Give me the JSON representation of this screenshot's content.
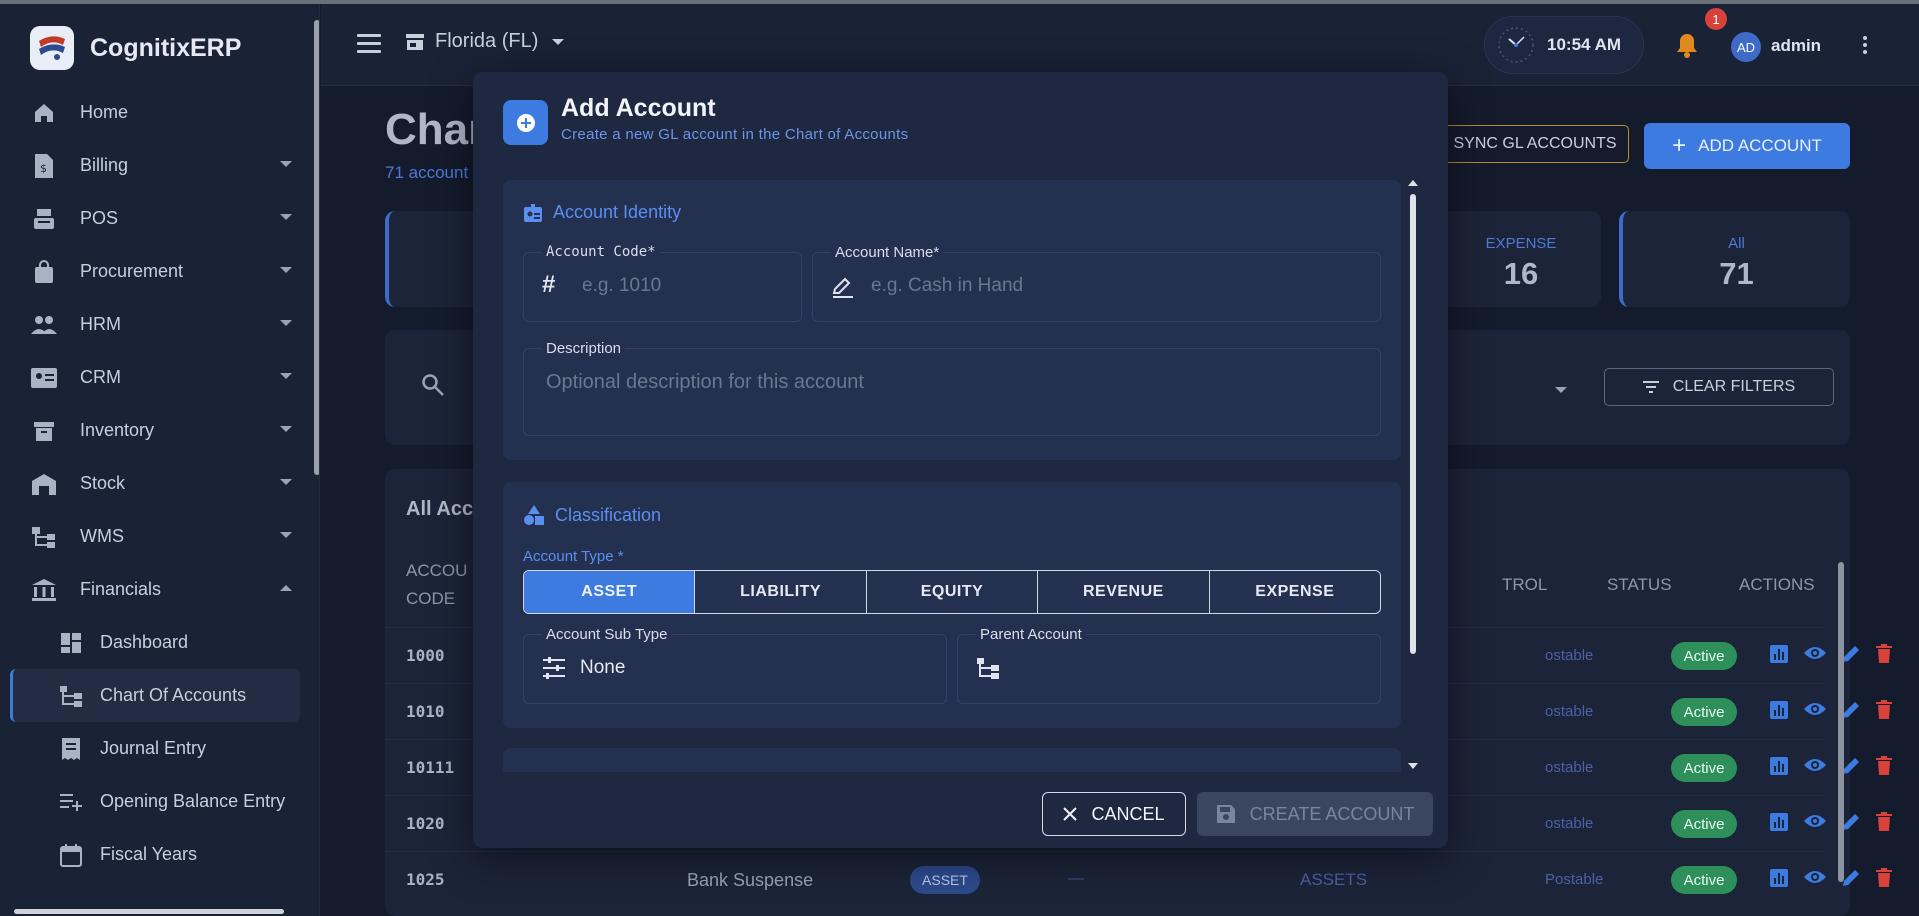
{
  "app": {
    "name": "CognitixERP"
  },
  "sidebar": {
    "items": [
      {
        "label": "Home",
        "icon": "home-icon"
      },
      {
        "label": "Billing",
        "icon": "billing-icon"
      },
      {
        "label": "POS",
        "icon": "pos-icon"
      },
      {
        "label": "Procurement",
        "icon": "bag-icon"
      },
      {
        "label": "HRM",
        "icon": "people-icon"
      },
      {
        "label": "CRM",
        "icon": "contact-card-icon"
      },
      {
        "label": "Inventory",
        "icon": "archive-icon"
      },
      {
        "label": "Stock",
        "icon": "warehouse-icon"
      },
      {
        "label": "WMS",
        "icon": "tree-icon"
      },
      {
        "label": "Financials",
        "icon": "bank-icon"
      }
    ],
    "financials_sub": [
      {
        "label": "Dashboard",
        "icon": "dashboard-icon"
      },
      {
        "label": "Chart Of Accounts",
        "icon": "account-tree-icon"
      },
      {
        "label": "Journal Entry",
        "icon": "receipt-icon"
      },
      {
        "label": "Opening Balance Entry",
        "icon": "playlist-add-icon"
      },
      {
        "label": "Fiscal Years",
        "icon": "calendar-icon"
      }
    ]
  },
  "topbar": {
    "store": "Florida (FL)",
    "time": "10:54 AM",
    "notifications": "1",
    "avatar_initials": "AD",
    "user": "admin"
  },
  "page": {
    "title": "Char",
    "subtitle": "71 account",
    "sync_button": "SYNC GL ACCOUNTS",
    "add_button": "ADD ACCOUNT",
    "clear_filters": "CLEAR FILTERS",
    "table_title": "All Acc"
  },
  "stats": [
    {
      "label": "EXPENSE",
      "value": "16"
    },
    {
      "label": "All",
      "value": "71"
    }
  ],
  "table": {
    "headers": {
      "code_1": "ACCOU",
      "code_2": "CODE",
      "control": "TROL",
      "status": "STATUS",
      "actions": "ACTIONS"
    },
    "rows": [
      {
        "code": "1000",
        "postable": "ostable",
        "status": "Active"
      },
      {
        "code": "1010",
        "postable": "ostable",
        "status": "Active"
      },
      {
        "code": "10111",
        "postable": "ostable",
        "status": "Active"
      },
      {
        "code": "1020",
        "postable": "ostable",
        "status": "Active"
      },
      {
        "code": "1025",
        "name": "Bank Suspense",
        "type": "ASSET",
        "parent": "—",
        "group": "ASSETS",
        "postable": "Postable",
        "status": "Active"
      }
    ]
  },
  "modal": {
    "title": "Add Account",
    "subtitle": "Create a new GL account in the Chart of Accounts",
    "identity": {
      "heading": "Account Identity",
      "code_label": "Account Code*",
      "code_placeholder": "e.g. 1010",
      "name_label": "Account Name*",
      "name_placeholder": "e.g. Cash in Hand",
      "desc_label": "Description",
      "desc_placeholder": "Optional description for this account"
    },
    "classification": {
      "heading": "Classification",
      "type_label": "Account Type *",
      "types": [
        "ASSET",
        "LIABILITY",
        "EQUITY",
        "REVENUE",
        "EXPENSE"
      ],
      "selected": "ASSET",
      "subtype_label": "Account Sub Type",
      "subtype_value": "None",
      "parent_label": "Parent Account",
      "parent_value": ""
    },
    "cancel": "CANCEL",
    "create": "CREATE ACCOUNT"
  },
  "colors": {
    "accent": "#3d7be0",
    "active": "#2e8f5b",
    "delete": "#d9423a"
  }
}
